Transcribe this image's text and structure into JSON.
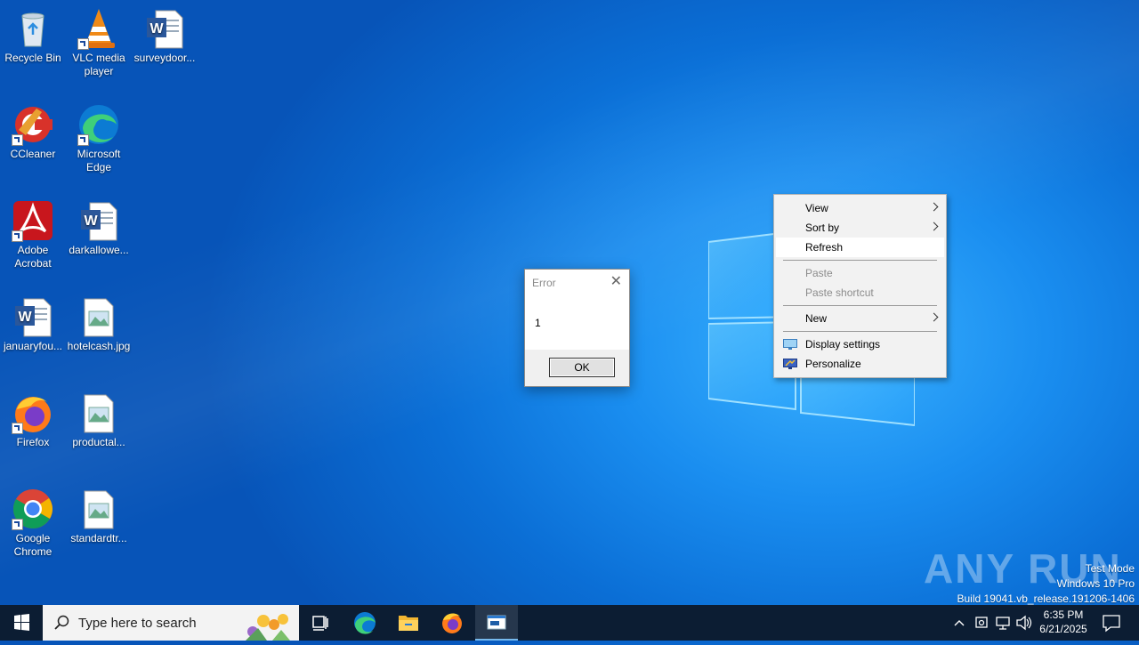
{
  "desktop": {
    "icons": [
      {
        "label": "Recycle Bin",
        "icon": "recycle-bin-icon"
      },
      {
        "label": "VLC media player",
        "icon": "vlc-icon"
      },
      {
        "label": "surveydoor...",
        "icon": "word-doc-icon"
      },
      {
        "label": "CCleaner",
        "icon": "ccleaner-icon"
      },
      {
        "label": "Microsoft Edge",
        "icon": "edge-icon"
      },
      {
        "label": "Adobe Acrobat",
        "icon": "acrobat-icon"
      },
      {
        "label": "darkallowe...",
        "icon": "word-doc-icon"
      },
      {
        "label": "januaryfou...",
        "icon": "word-doc-icon"
      },
      {
        "label": "hotelcash.jpg",
        "icon": "image-file-icon"
      },
      {
        "label": "Firefox",
        "icon": "firefox-icon"
      },
      {
        "label": "productal...",
        "icon": "image-file-icon"
      },
      {
        "label": "Google Chrome",
        "icon": "chrome-icon"
      },
      {
        "label": "standardtr...",
        "icon": "image-file-icon"
      }
    ]
  },
  "dialog": {
    "title": "Error",
    "message": "1",
    "ok_label": "OK"
  },
  "context_menu": {
    "items": [
      {
        "label": "View",
        "submenu": true,
        "enabled": true
      },
      {
        "label": "Sort by",
        "submenu": true,
        "enabled": true
      },
      {
        "label": "Refresh",
        "submenu": false,
        "enabled": true,
        "highlighted": true
      },
      {
        "label": "Paste",
        "submenu": false,
        "enabled": false
      },
      {
        "label": "Paste shortcut",
        "submenu": false,
        "enabled": false
      },
      {
        "label": "New",
        "submenu": true,
        "enabled": true
      },
      {
        "label": "Display settings",
        "submenu": false,
        "enabled": true,
        "icon": "display-settings-icon"
      },
      {
        "label": "Personalize",
        "submenu": false,
        "enabled": true,
        "icon": "personalize-icon"
      }
    ]
  },
  "watermark": {
    "brand": "ANY RUN",
    "line1": "Test Mode",
    "line2": "Windows 10 Pro",
    "line3": "Build 19041.vb_release.191206-1406"
  },
  "taskbar": {
    "search_placeholder": "Type here to search",
    "pinned": [
      "task-view-icon",
      "edge-icon",
      "file-explorer-icon",
      "firefox-icon",
      "app-window-icon"
    ],
    "clock_time": "6:35 PM",
    "clock_date": "6/21/2025"
  },
  "colors": {
    "wallpaper": "#0b6fd6",
    "taskbar": "#0c1d33",
    "menu_bg": "#f2f2f2"
  }
}
